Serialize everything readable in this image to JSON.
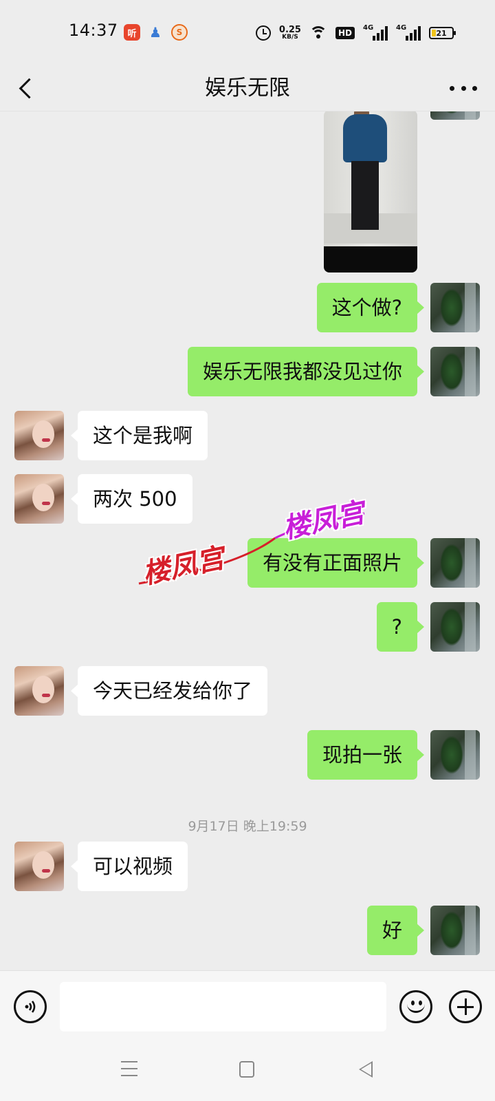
{
  "status_bar": {
    "time": "14:37",
    "app_icons": [
      "listen-app-icon",
      "qq-icon",
      "sogou-icon"
    ],
    "app_icon_glyphs": {
      "listen": "听",
      "qq": "♟",
      "sogou": "S"
    },
    "net_speed_value": "0.25",
    "net_speed_unit": "KB/S",
    "hd_label": "HD",
    "signal_label_1": "4G",
    "signal_label_2": "4G",
    "battery_level": "21"
  },
  "header": {
    "title": "娱乐无限"
  },
  "messages": [
    {
      "from": "me",
      "type": "image"
    },
    {
      "from": "me",
      "type": "text",
      "text": "这个做?"
    },
    {
      "from": "me",
      "type": "text",
      "text": "娱乐无限我都没见过你"
    },
    {
      "from": "other",
      "type": "text",
      "text": "这个是我啊"
    },
    {
      "from": "other",
      "type": "text",
      "text": "两次 500"
    },
    {
      "from": "me",
      "type": "text",
      "text": "有没有正面照片"
    },
    {
      "from": "me",
      "type": "text",
      "text": "?"
    },
    {
      "from": "other",
      "type": "text",
      "text": "今天已经发给你了"
    },
    {
      "from": "me",
      "type": "text",
      "text": "现拍一张"
    },
    {
      "from": "other",
      "type": "text",
      "text": "可以视频"
    },
    {
      "from": "me",
      "type": "text",
      "text": "好"
    }
  ],
  "timestamp": "9月17日 晚上19:59",
  "watermark": {
    "red_text": "楼凤宫",
    "purple_text": "楼凤宫",
    "red_color": "#d6202a",
    "purple_color": "#c81fd8"
  },
  "input": {
    "value": "",
    "placeholder": ""
  },
  "colors": {
    "bubble_me": "#95ec69",
    "bubble_other": "#ffffff",
    "background": "#ededed"
  }
}
